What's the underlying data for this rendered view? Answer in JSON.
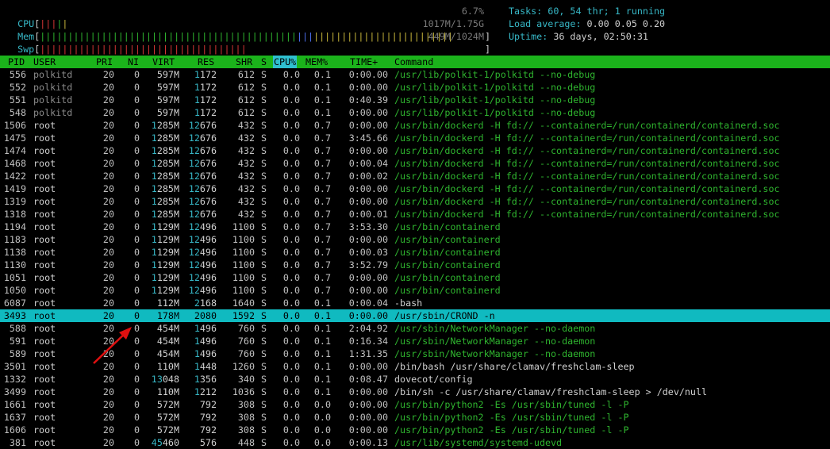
{
  "meters": {
    "cpu": {
      "label": "CPU",
      "value": "6.7%",
      "bar_segments": 4
    },
    "mem": {
      "label": "Mem",
      "value": "1017M/1.75G"
    },
    "swp": {
      "label": "Swp",
      "value": "449M/1024M"
    }
  },
  "summary": {
    "tasks_label": "Tasks:",
    "tasks_value": "60, 54 thr; 1 running",
    "load_label": "Load average:",
    "load_value": "0.00 0.05 0.20",
    "uptime_label": "Uptime:",
    "uptime_value": "36 days, 02:50:31"
  },
  "columns": {
    "pid": "PID",
    "user": "USER",
    "pri": "PRI",
    "ni": "NI",
    "virt": "VIRT",
    "res": "RES",
    "shr": "SHR",
    "s": "S",
    "cpu": "CPU%",
    "mem": "MEM%",
    "time": "TIME+",
    "command": "Command"
  },
  "processes": [
    {
      "pid": "556",
      "user": "polkitd",
      "pri": "20",
      "ni": "0",
      "virt": "597M",
      "res": "1172",
      "shr": "612",
      "s": "S",
      "cpu": "0.0",
      "mem": "0.1",
      "time": "0:00.00",
      "command": "/usr/lib/polkit-1/polkitd --no-debug"
    },
    {
      "pid": "552",
      "user": "polkitd",
      "pri": "20",
      "ni": "0",
      "virt": "597M",
      "res": "1172",
      "shr": "612",
      "s": "S",
      "cpu": "0.0",
      "mem": "0.1",
      "time": "0:00.00",
      "command": "/usr/lib/polkit-1/polkitd --no-debug"
    },
    {
      "pid": "551",
      "user": "polkitd",
      "pri": "20",
      "ni": "0",
      "virt": "597M",
      "res": "1172",
      "shr": "612",
      "s": "S",
      "cpu": "0.0",
      "mem": "0.1",
      "time": "0:40.39",
      "command": "/usr/lib/polkit-1/polkitd --no-debug"
    },
    {
      "pid": "548",
      "user": "polkitd",
      "pri": "20",
      "ni": "0",
      "virt": "597M",
      "res": "1172",
      "shr": "612",
      "s": "S",
      "cpu": "0.0",
      "mem": "0.1",
      "time": "0:00.00",
      "command": "/usr/lib/polkit-1/polkitd --no-debug"
    },
    {
      "pid": "1506",
      "user": "root",
      "pri": "20",
      "ni": "0",
      "virt": "1285M",
      "res": "12676",
      "shr": "432",
      "s": "S",
      "cpu": "0.0",
      "mem": "0.7",
      "time": "0:00.00",
      "command": "/usr/bin/dockerd -H fd:// --containerd=/run/containerd/containerd.soc"
    },
    {
      "pid": "1475",
      "user": "root",
      "pri": "20",
      "ni": "0",
      "virt": "1285M",
      "res": "12676",
      "shr": "432",
      "s": "S",
      "cpu": "0.0",
      "mem": "0.7",
      "time": "3:45.66",
      "command": "/usr/bin/dockerd -H fd:// --containerd=/run/containerd/containerd.soc"
    },
    {
      "pid": "1474",
      "user": "root",
      "pri": "20",
      "ni": "0",
      "virt": "1285M",
      "res": "12676",
      "shr": "432",
      "s": "S",
      "cpu": "0.0",
      "mem": "0.7",
      "time": "0:00.00",
      "command": "/usr/bin/dockerd -H fd:// --containerd=/run/containerd/containerd.soc"
    },
    {
      "pid": "1468",
      "user": "root",
      "pri": "20",
      "ni": "0",
      "virt": "1285M",
      "res": "12676",
      "shr": "432",
      "s": "S",
      "cpu": "0.0",
      "mem": "0.7",
      "time": "0:00.04",
      "command": "/usr/bin/dockerd -H fd:// --containerd=/run/containerd/containerd.soc"
    },
    {
      "pid": "1422",
      "user": "root",
      "pri": "20",
      "ni": "0",
      "virt": "1285M",
      "res": "12676",
      "shr": "432",
      "s": "S",
      "cpu": "0.0",
      "mem": "0.7",
      "time": "0:00.02",
      "command": "/usr/bin/dockerd -H fd:// --containerd=/run/containerd/containerd.soc"
    },
    {
      "pid": "1419",
      "user": "root",
      "pri": "20",
      "ni": "0",
      "virt": "1285M",
      "res": "12676",
      "shr": "432",
      "s": "S",
      "cpu": "0.0",
      "mem": "0.7",
      "time": "0:00.00",
      "command": "/usr/bin/dockerd -H fd:// --containerd=/run/containerd/containerd.soc"
    },
    {
      "pid": "1319",
      "user": "root",
      "pri": "20",
      "ni": "0",
      "virt": "1285M",
      "res": "12676",
      "shr": "432",
      "s": "S",
      "cpu": "0.0",
      "mem": "0.7",
      "time": "0:00.00",
      "command": "/usr/bin/dockerd -H fd:// --containerd=/run/containerd/containerd.soc"
    },
    {
      "pid": "1318",
      "user": "root",
      "pri": "20",
      "ni": "0",
      "virt": "1285M",
      "res": "12676",
      "shr": "432",
      "s": "S",
      "cpu": "0.0",
      "mem": "0.7",
      "time": "0:00.01",
      "command": "/usr/bin/dockerd -H fd:// --containerd=/run/containerd/containerd.soc"
    },
    {
      "pid": "1194",
      "user": "root",
      "pri": "20",
      "ni": "0",
      "virt": "1129M",
      "res": "12496",
      "shr": "1100",
      "s": "S",
      "cpu": "0.0",
      "mem": "0.7",
      "time": "3:53.30",
      "command": "/usr/bin/containerd"
    },
    {
      "pid": "1183",
      "user": "root",
      "pri": "20",
      "ni": "0",
      "virt": "1129M",
      "res": "12496",
      "shr": "1100",
      "s": "S",
      "cpu": "0.0",
      "mem": "0.7",
      "time": "0:00.00",
      "command": "/usr/bin/containerd"
    },
    {
      "pid": "1138",
      "user": "root",
      "pri": "20",
      "ni": "0",
      "virt": "1129M",
      "res": "12496",
      "shr": "1100",
      "s": "S",
      "cpu": "0.0",
      "mem": "0.7",
      "time": "0:00.03",
      "command": "/usr/bin/containerd"
    },
    {
      "pid": "1130",
      "user": "root",
      "pri": "20",
      "ni": "0",
      "virt": "1129M",
      "res": "12496",
      "shr": "1100",
      "s": "S",
      "cpu": "0.0",
      "mem": "0.7",
      "time": "3:52.79",
      "command": "/usr/bin/containerd"
    },
    {
      "pid": "1051",
      "user": "root",
      "pri": "20",
      "ni": "0",
      "virt": "1129M",
      "res": "12496",
      "shr": "1100",
      "s": "S",
      "cpu": "0.0",
      "mem": "0.7",
      "time": "0:00.00",
      "command": "/usr/bin/containerd"
    },
    {
      "pid": "1050",
      "user": "root",
      "pri": "20",
      "ni": "0",
      "virt": "1129M",
      "res": "12496",
      "shr": "1100",
      "s": "S",
      "cpu": "0.0",
      "mem": "0.7",
      "time": "0:00.00",
      "command": "/usr/bin/containerd"
    },
    {
      "pid": "6087",
      "user": "root",
      "pri": "20",
      "ni": "0",
      "virt": "112M",
      "res": "2168",
      "shr": "1640",
      "s": "S",
      "cpu": "0.0",
      "mem": "0.1",
      "time": "0:00.04",
      "command": "-bash"
    },
    {
      "pid": "3493",
      "user": "root",
      "pri": "20",
      "ni": "0",
      "virt": "178M",
      "res": "2080",
      "shr": "1592",
      "s": "S",
      "cpu": "0.0",
      "mem": "0.1",
      "time": "0:00.00",
      "command": "/usr/sbin/CROND -n",
      "selected": true
    },
    {
      "pid": "588",
      "user": "root",
      "pri": "20",
      "ni": "0",
      "virt": "454M",
      "res": "1496",
      "shr": "760",
      "s": "S",
      "cpu": "0.0",
      "mem": "0.1",
      "time": "2:04.92",
      "command": "/usr/sbin/NetworkManager --no-daemon"
    },
    {
      "pid": "591",
      "user": "root",
      "pri": "20",
      "ni": "0",
      "virt": "454M",
      "res": "1496",
      "shr": "760",
      "s": "S",
      "cpu": "0.0",
      "mem": "0.1",
      "time": "0:16.34",
      "command": "/usr/sbin/NetworkManager --no-daemon"
    },
    {
      "pid": "589",
      "user": "root",
      "pri": "20",
      "ni": "0",
      "virt": "454M",
      "res": "1496",
      "shr": "760",
      "s": "S",
      "cpu": "0.0",
      "mem": "0.1",
      "time": "1:31.35",
      "command": "/usr/sbin/NetworkManager --no-daemon"
    },
    {
      "pid": "3501",
      "user": "root",
      "pri": "20",
      "ni": "0",
      "virt": "110M",
      "res": "1448",
      "shr": "1260",
      "s": "S",
      "cpu": "0.0",
      "mem": "0.1",
      "time": "0:00.00",
      "command": "/bin/bash /usr/share/clamav/freshclam-sleep"
    },
    {
      "pid": "1332",
      "user": "root",
      "pri": "20",
      "ni": "0",
      "virt": "13048",
      "res": "1356",
      "shr": "340",
      "s": "S",
      "cpu": "0.0",
      "mem": "0.1",
      "time": "0:08.47",
      "command": "dovecot/config"
    },
    {
      "pid": "3499",
      "user": "root",
      "pri": "20",
      "ni": "0",
      "virt": "110M",
      "res": "1212",
      "shr": "1036",
      "s": "S",
      "cpu": "0.0",
      "mem": "0.1",
      "time": "0:00.00",
      "command": "/bin/sh -c /usr/share/clamav/freshclam-sleep > /dev/null"
    },
    {
      "pid": "1661",
      "user": "root",
      "pri": "20",
      "ni": "0",
      "virt": "572M",
      "res": "792",
      "shr": "308",
      "s": "S",
      "cpu": "0.0",
      "mem": "0.0",
      "time": "0:00.00",
      "command": "/usr/bin/python2 -Es /usr/sbin/tuned -l -P"
    },
    {
      "pid": "1637",
      "user": "root",
      "pri": "20",
      "ni": "0",
      "virt": "572M",
      "res": "792",
      "shr": "308",
      "s": "S",
      "cpu": "0.0",
      "mem": "0.0",
      "time": "0:00.00",
      "command": "/usr/bin/python2 -Es /usr/sbin/tuned -l -P"
    },
    {
      "pid": "1606",
      "user": "root",
      "pri": "20",
      "ni": "0",
      "virt": "572M",
      "res": "792",
      "shr": "308",
      "s": "S",
      "cpu": "0.0",
      "mem": "0.0",
      "time": "0:00.00",
      "command": "/usr/bin/python2 -Es /usr/sbin/tuned -l -P"
    },
    {
      "pid": "381",
      "user": "root",
      "pri": "20",
      "ni": "0",
      "virt": "45460",
      "res": "576",
      "shr": "448",
      "s": "S",
      "cpu": "0.0",
      "mem": "0.0",
      "time": "0:00.13",
      "command": "/usr/lib/systemd/systemd-udevd"
    }
  ],
  "colors": {
    "header_bg": "#1bb31b",
    "selected_bg": "#10bac0",
    "annotation_arrow": "#e01010"
  }
}
